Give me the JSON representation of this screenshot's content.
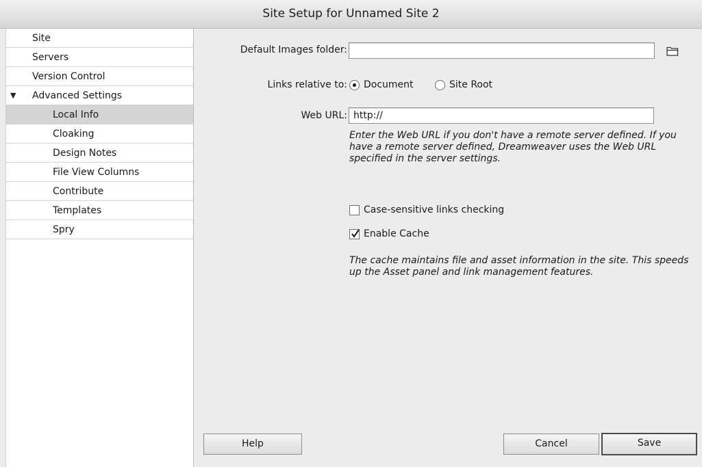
{
  "window": {
    "title": "Site Setup for Unnamed Site 2"
  },
  "sidebar": {
    "items": [
      {
        "label": "Site",
        "level": 1
      },
      {
        "label": "Servers",
        "level": 1
      },
      {
        "label": "Version Control",
        "level": 1
      },
      {
        "label": "Advanced Settings",
        "level": 1,
        "expanded": true
      },
      {
        "label": "Local Info",
        "level": 2,
        "selected": true
      },
      {
        "label": "Cloaking",
        "level": 2
      },
      {
        "label": "Design Notes",
        "level": 2
      },
      {
        "label": "File View Columns",
        "level": 2
      },
      {
        "label": "Contribute",
        "level": 2
      },
      {
        "label": "Templates",
        "level": 2
      },
      {
        "label": "Spry",
        "level": 2
      }
    ],
    "expand_glyph": "▼"
  },
  "form": {
    "images_folder": {
      "label": "Default Images folder:",
      "value": "",
      "icon": "folder-icon"
    },
    "links_relative": {
      "label": "Links relative to:",
      "options": [
        {
          "label": "Document",
          "selected": true
        },
        {
          "label": "Site Root",
          "selected": false
        }
      ]
    },
    "web_url": {
      "label": "Web URL:",
      "value": "http://",
      "help": "Enter the Web URL if you don't have a remote server defined. If you have a remote server defined, Dreamweaver uses the Web URL specified in the server settings."
    },
    "case_sensitive": {
      "label": "Case-sensitive links checking",
      "checked": false
    },
    "enable_cache": {
      "label": "Enable Cache",
      "checked": true
    },
    "cache_help": "The cache maintains file and asset information in the site. This speeds up the Asset panel and link management features."
  },
  "buttons": {
    "help": "Help",
    "cancel": "Cancel",
    "save": "Save"
  }
}
